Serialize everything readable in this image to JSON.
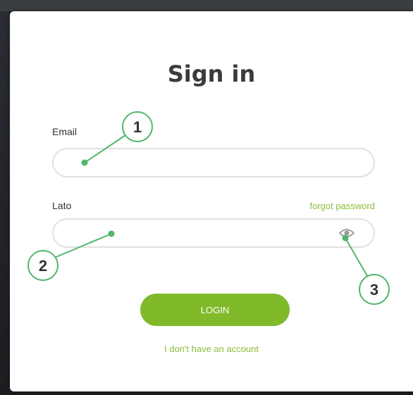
{
  "dialog": {
    "title": "Sign in",
    "email_label": "Email",
    "email_value": "",
    "password_label": "Lato",
    "password_value": "",
    "forgot_password": "forgot password",
    "login_button": "LOGIN",
    "no_account_link": "I don't have an account"
  },
  "callouts": [
    "1",
    "2",
    "3"
  ],
  "colors": {
    "accent": "#80b92a",
    "callout": "#52b56c"
  },
  "icons": {
    "password_toggle": "eye-icon"
  }
}
